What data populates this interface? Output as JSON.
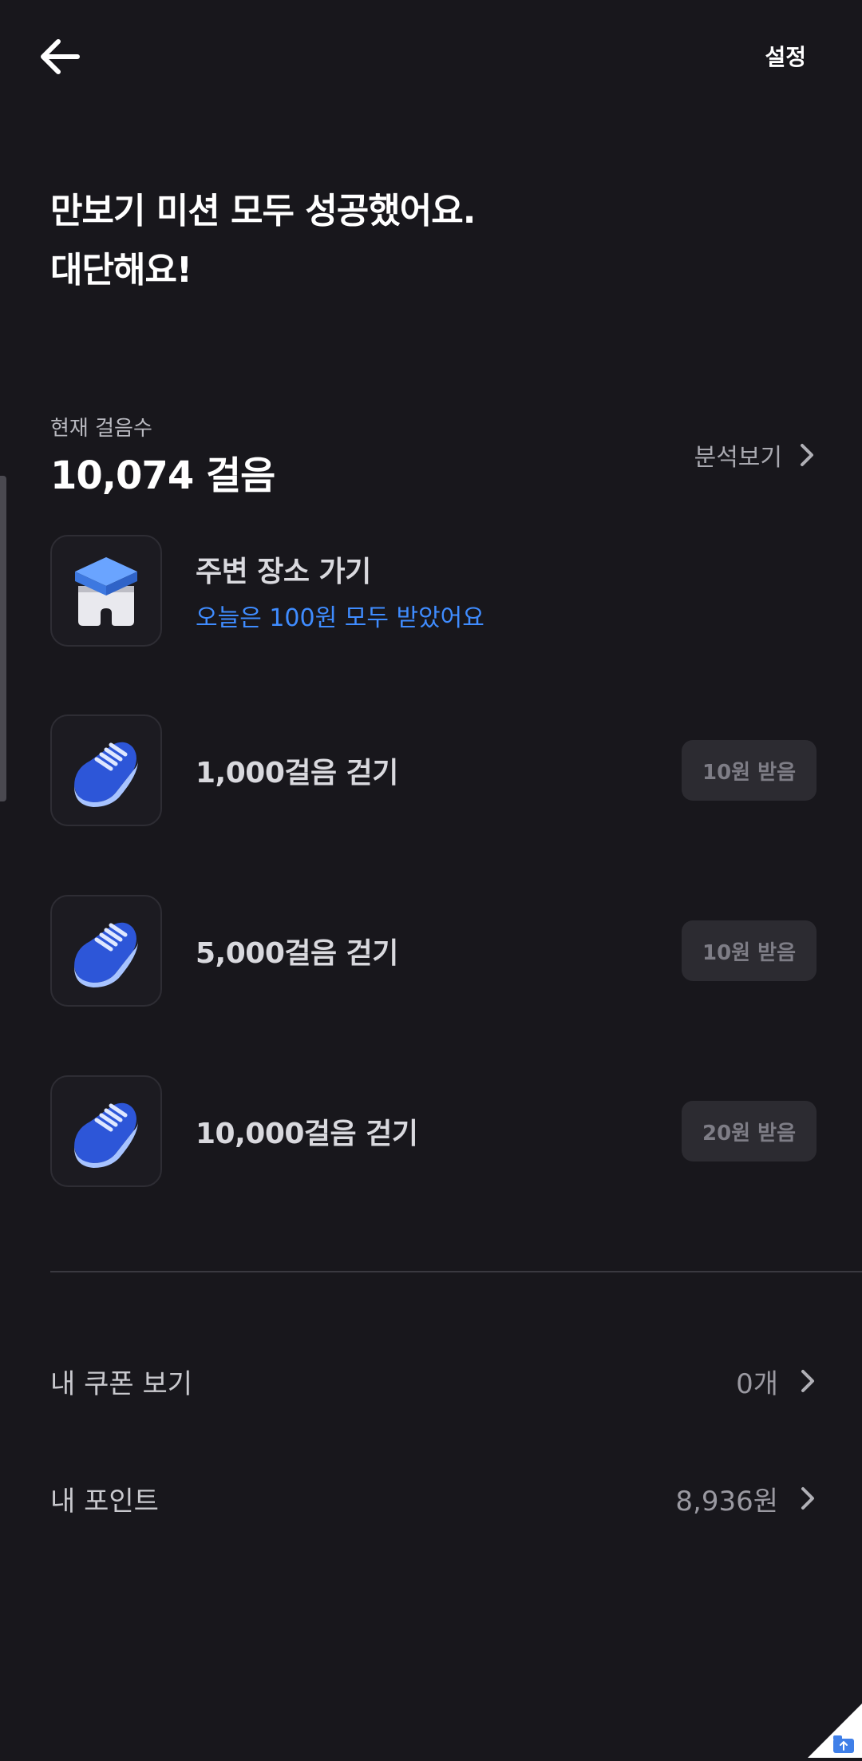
{
  "header": {
    "back_icon": "arrow-left-icon",
    "settings_label": "설정"
  },
  "headline": {
    "line1": "만보기 미션 모두 성공했어요.",
    "line2": "대단해요!"
  },
  "steps": {
    "label": "현재 걸음수",
    "value": "10,074 걸음",
    "analysis_label": "분석보기",
    "analysis_icon": "chevron-right-icon"
  },
  "missions": [
    {
      "title": "주변 장소 가기",
      "subtitle": "오늘은 100원 모두 받았어요",
      "icon": "building-stamp-icon",
      "subtitle_color": "#3f8cff"
    },
    {
      "title": "1,000걸음 걷기",
      "reward_label": "10원 받음",
      "icon": "sneaker-icon"
    },
    {
      "title": "5,000걸음 걷기",
      "reward_label": "10원 받음",
      "icon": "sneaker-icon"
    },
    {
      "title": "10,000걸음 걷기",
      "reward_label": "20원 받음",
      "icon": "sneaker-icon"
    }
  ],
  "links": {
    "coupons": {
      "label": "내 쿠폰 보기",
      "value": "0개",
      "icon": "chevron-right-icon"
    },
    "points": {
      "label": "내 포인트",
      "value": "8,936원",
      "icon": "chevron-right-icon"
    }
  },
  "colors": {
    "background": "#18171c",
    "accent_blue": "#3f8cff",
    "button_bg": "#2c2b31"
  }
}
